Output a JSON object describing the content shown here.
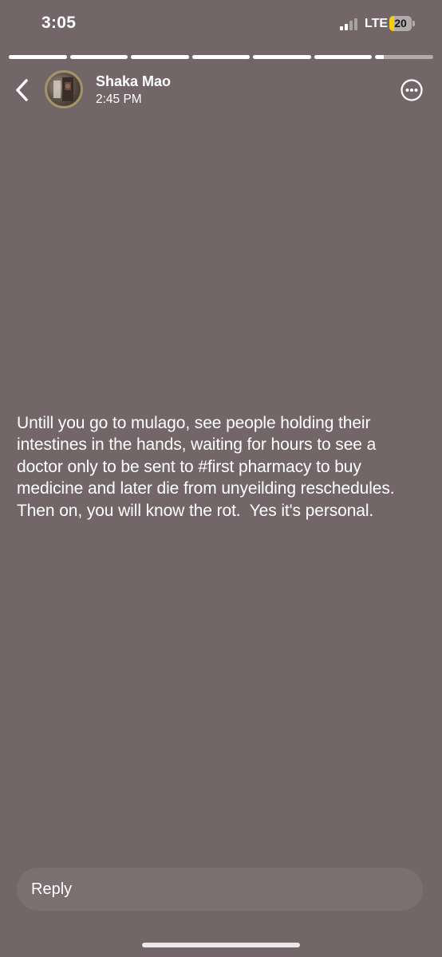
{
  "status_bar": {
    "time": "3:05",
    "network": "LTE",
    "battery": "20",
    "battery_level": 0.2,
    "signal_bars_active": 2,
    "signal_bars_total": 4,
    "battery_color": "#f5d000"
  },
  "story": {
    "segments_total": 7,
    "segments_completed": 6,
    "current_segment_progress": 0.15,
    "background_color": "#726668",
    "author": {
      "name": "Shaka Mao",
      "timestamp": "2:45 PM"
    },
    "text": "Untill you go to mulago, see people holding their intestines in the hands, waiting for hours to see a doctor only to be sent to #first pharmacy to buy medicine and later die from unyeilding reschedules. Then on, you will know the rot.  Yes it's personal."
  },
  "icons": {
    "back": "chevron-left-icon",
    "more": "ellipsis-circle-icon"
  },
  "reply": {
    "placeholder": "Reply"
  }
}
